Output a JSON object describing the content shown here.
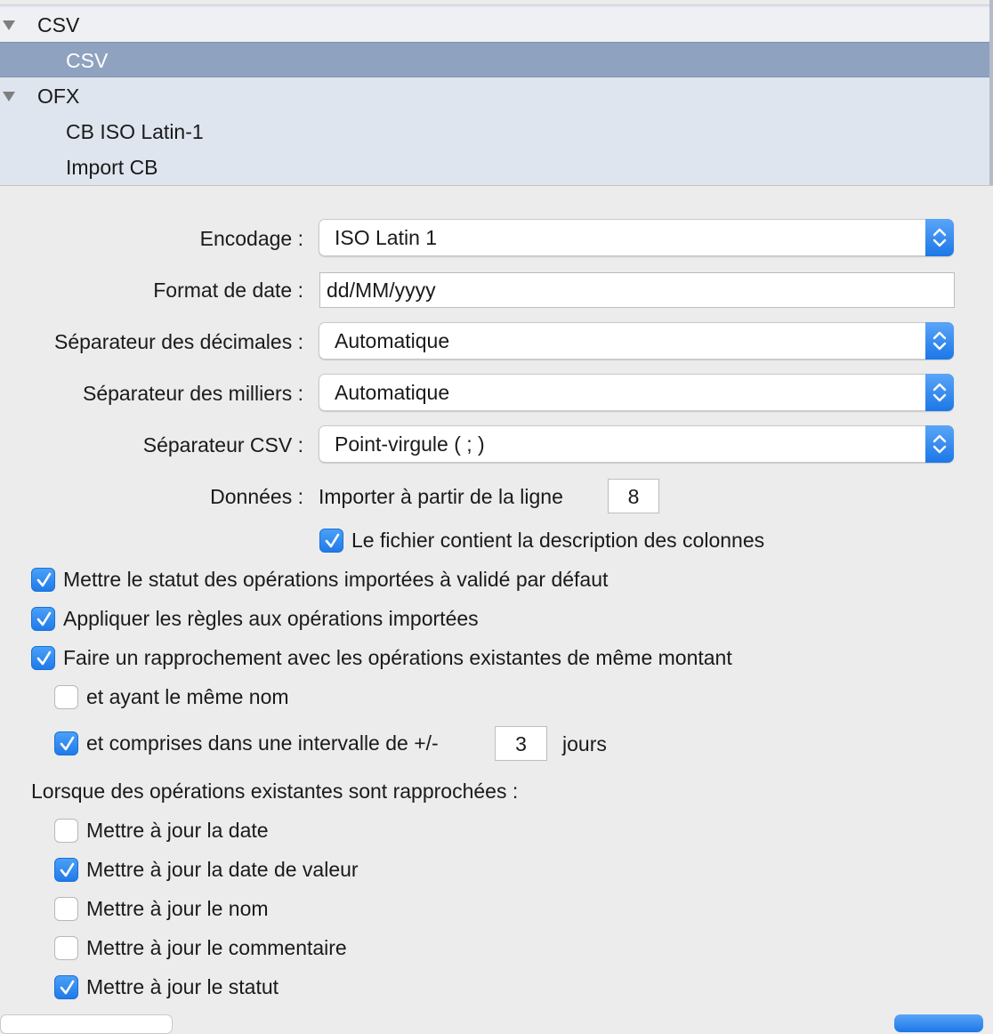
{
  "outline": {
    "items": [
      {
        "label": "CSV"
      },
      {
        "label": "CSV"
      },
      {
        "label": "OFX"
      },
      {
        "label": "CB ISO Latin-1"
      },
      {
        "label": "Import CB"
      }
    ]
  },
  "form": {
    "encoding": {
      "label": "Encodage :",
      "value": "ISO Latin 1"
    },
    "date_format": {
      "label": "Format de date :",
      "value": "dd/MM/yyyy"
    },
    "decimal_separator": {
      "label": "Séparateur des décimales :",
      "value": "Automatique"
    },
    "thousands_separator": {
      "label": "Séparateur des milliers :",
      "value": "Automatique"
    },
    "csv_separator": {
      "label": "Séparateur CSV :",
      "value": "Point-virgule ( ; )"
    },
    "data": {
      "label": "Données :",
      "import_from_line_label": "Importer à partir de la ligne",
      "import_from_line_value": "8"
    },
    "header_row": {
      "label": "Le fichier contient la description des colonnes",
      "checked": true
    }
  },
  "options": {
    "set_validated": {
      "label": "Mettre le statut des opérations importées à validé par défaut",
      "checked": true
    },
    "apply_rules": {
      "label": "Appliquer les règles aux opérations importées",
      "checked": true
    },
    "match_same_amount": {
      "label": "Faire un rapprochement avec les opérations existantes de même montant",
      "checked": true
    },
    "same_name": {
      "label": "et ayant le même nom",
      "checked": false
    },
    "interval": {
      "label": "et comprises dans une intervalle de +/-",
      "value": "3",
      "unit": "jours",
      "checked": true
    }
  },
  "matched": {
    "heading": "Lorsque des opérations existantes sont rapprochées :",
    "update_date": {
      "label": "Mettre à jour la date",
      "checked": false
    },
    "update_value_date": {
      "label": "Mettre à jour la date de valeur",
      "checked": true
    },
    "update_name": {
      "label": "Mettre à jour le nom",
      "checked": false
    },
    "update_comment": {
      "label": "Mettre à jour le commentaire",
      "checked": false
    },
    "update_status": {
      "label": "Mettre à jour le statut",
      "checked": true
    }
  }
}
